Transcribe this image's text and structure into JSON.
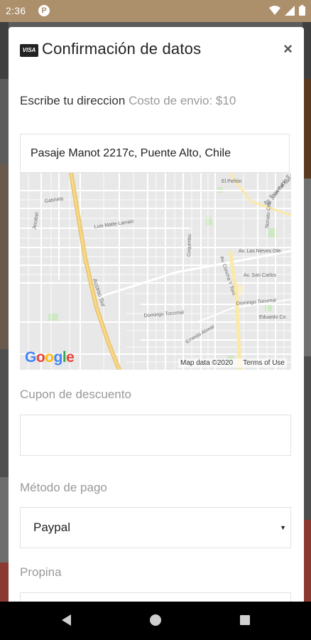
{
  "status_bar": {
    "time": "2:36",
    "app_badge": "P"
  },
  "modal": {
    "title": "Confirmación de datos",
    "card_icon_text": "VISA",
    "close_label": "×"
  },
  "address": {
    "label": "Escribe tu direccion",
    "shipping_cost": "Costo de envio: $10",
    "value": "Pasaje Manot 2217c, Puente Alto, Chile"
  },
  "map": {
    "logo": "Google",
    "data_attribution": "Map data ©2020",
    "terms": "Terms of Use",
    "street_labels": [
      "El Peñón",
      "Av. Juan Pablo II",
      "Gabriela",
      "Jezabel",
      "Luis Matte Larrain",
      "Coquimbo",
      "Av. Las Nieves Ote.",
      "Av. Concha Y Toro",
      "Av. San Carlos",
      "Acceso Sur",
      "Domingo Tocornal",
      "Domingo Tocornal",
      "Ernesto Alvear",
      "Eduardo Co",
      "Nonato Coo",
      "Av. Tocornal San Fr"
    ]
  },
  "discount": {
    "label": "Cupon de descuento",
    "value": ""
  },
  "payment": {
    "label": "Método de pago",
    "selected": "Paypal"
  },
  "tip": {
    "label": "Propina"
  }
}
